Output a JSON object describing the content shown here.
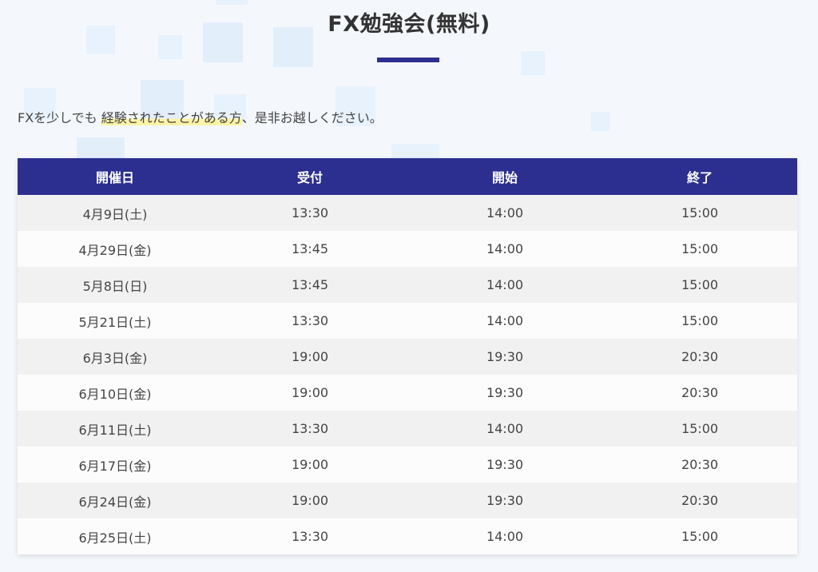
{
  "heading": {
    "title": "FX勉強会(無料)"
  },
  "intro": {
    "before": "FXを少しでも",
    "highlight": "経験されたことがある方",
    "after": "、是非お越しください。"
  },
  "schedule": {
    "headers": [
      "開催日",
      "受付",
      "開始",
      "終了"
    ],
    "rows": [
      [
        "4月9日(土)",
        "13:30",
        "14:00",
        "15:00"
      ],
      [
        "4月29日(金)",
        "13:45",
        "14:00",
        "15:00"
      ],
      [
        "5月8日(日)",
        "13:45",
        "14:00",
        "15:00"
      ],
      [
        "5月21日(土)",
        "13:30",
        "14:00",
        "15:00"
      ],
      [
        "6月3日(金)",
        "19:00",
        "19:30",
        "20:30"
      ],
      [
        "6月10日(金)",
        "19:00",
        "19:30",
        "20:30"
      ],
      [
        "6月11日(土)",
        "13:30",
        "14:00",
        "15:00"
      ],
      [
        "6月17日(金)",
        "19:00",
        "19:30",
        "20:30"
      ],
      [
        "6月24日(金)",
        "19:00",
        "19:30",
        "20:30"
      ],
      [
        "6月25日(土)",
        "13:30",
        "14:00",
        "15:00"
      ]
    ]
  },
  "colors": {
    "accent": "#2c2f8f",
    "highlight": "#fbf3a6",
    "row_shaded": "#f1f1f1",
    "row_plain": "#fcfcfc"
  }
}
